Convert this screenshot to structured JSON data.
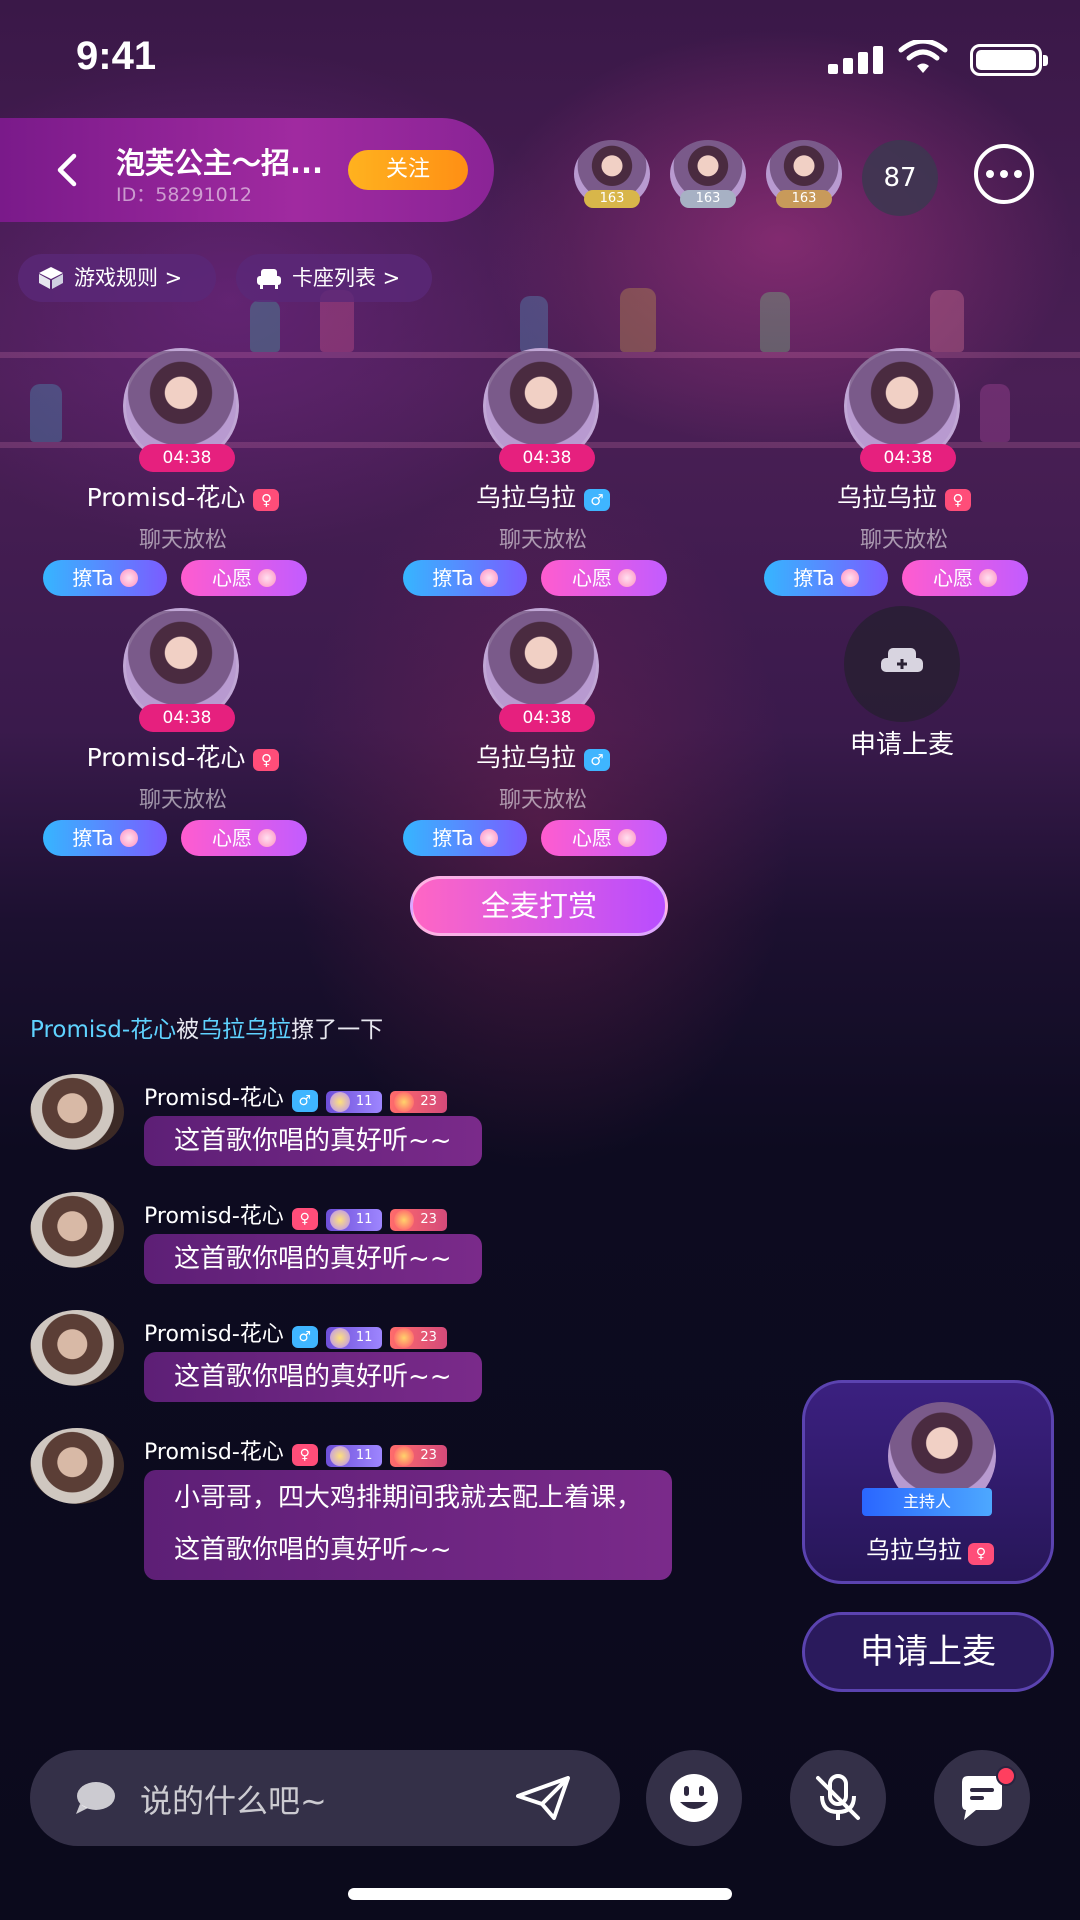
{
  "status": {
    "time": "9:41"
  },
  "room": {
    "title": "泡芙公主～招...",
    "id": "ID：58291012",
    "follow_label": "关注",
    "viewers": [
      {
        "badge": "163",
        "badge_color": "#d8b64a"
      },
      {
        "badge": "163",
        "badge_color": "#a7b1c4"
      },
      {
        "badge": "163",
        "badge_color": "#c89a5a"
      }
    ],
    "viewer_count": "87"
  },
  "tags": {
    "rules": "游戏规则 >",
    "seats_list": "卡座列表 >"
  },
  "seats": [
    {
      "timer": "04:38",
      "name": "Promisd-花心",
      "gender": "female",
      "gender_icon": "♀",
      "slogan": "聊天放松",
      "flirt": "撩Ta",
      "wish": "心愿"
    },
    {
      "timer": "04:38",
      "name": "乌拉乌拉",
      "gender": "male",
      "gender_icon": "♂",
      "slogan": "聊天放松",
      "flirt": "撩Ta",
      "wish": "心愿"
    },
    {
      "timer": "04:38",
      "name": "乌拉乌拉",
      "gender": "female",
      "gender_icon": "♀",
      "slogan": "聊天放松",
      "flirt": "撩Ta",
      "wish": "心愿"
    },
    {
      "timer": "04:38",
      "name": "Promisd-花心",
      "gender": "female",
      "gender_icon": "♀",
      "slogan": "聊天放松",
      "flirt": "撩Ta",
      "wish": "心愿"
    },
    {
      "timer": "04:38",
      "name": "乌拉乌拉",
      "gender": "male",
      "gender_icon": "♂",
      "slogan": "聊天放松",
      "flirt": "撩Ta",
      "wish": "心愿"
    }
  ],
  "empty_seat": {
    "label": "申请上麦"
  },
  "reward_all": "全麦打赏",
  "system_message": {
    "user1": "Promisd-花心",
    "text1": "被",
    "user2": "乌拉乌拉",
    "text2": "撩了一下"
  },
  "messages": [
    {
      "name": "Promisd-花心",
      "gender": "male",
      "gender_icon": "♂",
      "level_a": "11",
      "level_b": "23",
      "text": "这首歌你唱的真好听~~"
    },
    {
      "name": "Promisd-花心",
      "gender": "female",
      "gender_icon": "♀",
      "level_a": "11",
      "level_b": "23",
      "text": "这首歌你唱的真好听~~"
    },
    {
      "name": "Promisd-花心",
      "gender": "male",
      "gender_icon": "♂",
      "level_a": "11",
      "level_b": "23",
      "text": "这首歌你唱的真好听~~"
    },
    {
      "name": "Promisd-花心",
      "gender": "female",
      "gender_icon": "♀",
      "level_a": "11",
      "level_b": "23",
      "text_line1": "小哥哥，四大鸡排期间我就去配上着课，",
      "text_line2": "这首歌你唱的真好听~~"
    }
  ],
  "host": {
    "tag": "主持人",
    "name": "乌拉乌拉",
    "gender_icon": "♀"
  },
  "apply_mic": "申请上麦",
  "input": {
    "placeholder": "说的什么吧~"
  },
  "icons": {
    "back": "chevron-left-icon",
    "more": "more-icon",
    "rules": "dice-icon",
    "seats": "sofa-icon",
    "send": "send-icon",
    "emoji": "emoji-icon",
    "mic_off": "mic-off-icon",
    "chat": "chat-icon"
  }
}
